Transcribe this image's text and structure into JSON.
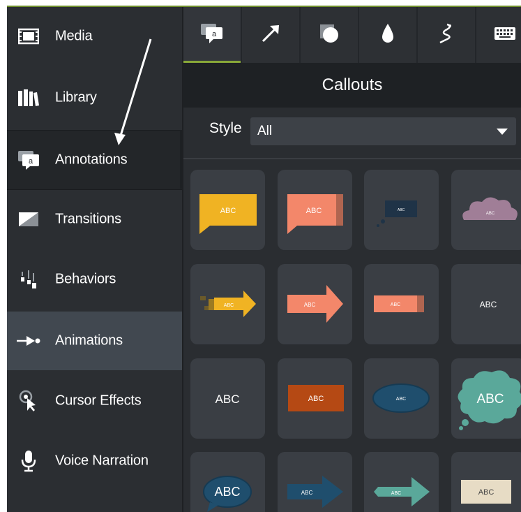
{
  "sidebar": {
    "items": [
      {
        "label": "Media",
        "icon": "film-strip-icon"
      },
      {
        "label": "Library",
        "icon": "books-icon"
      },
      {
        "label": "Annotations",
        "icon": "speech-bubble-icon"
      },
      {
        "label": "Transitions",
        "icon": "transition-icon"
      },
      {
        "label": "Behaviors",
        "icon": "behaviors-icon"
      },
      {
        "label": "Animations",
        "icon": "animation-arrow-icon"
      },
      {
        "label": "Cursor Effects",
        "icon": "cursor-effects-icon"
      },
      {
        "label": "Voice Narration",
        "icon": "microphone-icon"
      }
    ],
    "selected": "Annotations",
    "hovered": "Animations"
  },
  "tabs": [
    {
      "icon": "callout-bubble-icon",
      "active": true
    },
    {
      "icon": "arrow-line-icon",
      "active": false
    },
    {
      "icon": "shapes-icon",
      "active": false
    },
    {
      "icon": "blur-drop-icon",
      "active": false
    },
    {
      "icon": "sketch-motion-icon",
      "active": false
    },
    {
      "icon": "keyboard-icon",
      "active": false
    }
  ],
  "panel": {
    "title": "Callouts",
    "style_label": "Style",
    "style_value": "All"
  },
  "callouts": [
    {
      "text": "ABC",
      "kind": "speech-rect"
    },
    {
      "text": "ABC",
      "kind": "speech-rect-shadow"
    },
    {
      "text": "ABC",
      "kind": "thought-small"
    },
    {
      "text": "ABC",
      "kind": "cloud"
    },
    {
      "text": "ABC",
      "kind": "arrow-trail"
    },
    {
      "text": "ABC",
      "kind": "arrow"
    },
    {
      "text": "ABC",
      "kind": "banner"
    },
    {
      "text": "ABC",
      "kind": "text"
    },
    {
      "text": "ABC",
      "kind": "text"
    },
    {
      "text": "ABC",
      "kind": "rect"
    },
    {
      "text": "ABC",
      "kind": "ellipse"
    },
    {
      "text": "ABC",
      "kind": "cloud-thought"
    },
    {
      "text": "ABC",
      "kind": "oval-speech"
    },
    {
      "text": "ABC",
      "kind": "arrow"
    },
    {
      "text": "ABC",
      "kind": "arrow"
    },
    {
      "text": "ABC",
      "kind": "rect"
    }
  ],
  "colors": {
    "accent": "#88a838",
    "yellow": "#f0b323",
    "salmon": "#f3876a",
    "navy": "#1f3347",
    "mauve": "#a07e97",
    "rust": "#b54914",
    "teal": "#5aa89a",
    "blue": "#1f4e6d",
    "beige": "#e7dcc5"
  }
}
